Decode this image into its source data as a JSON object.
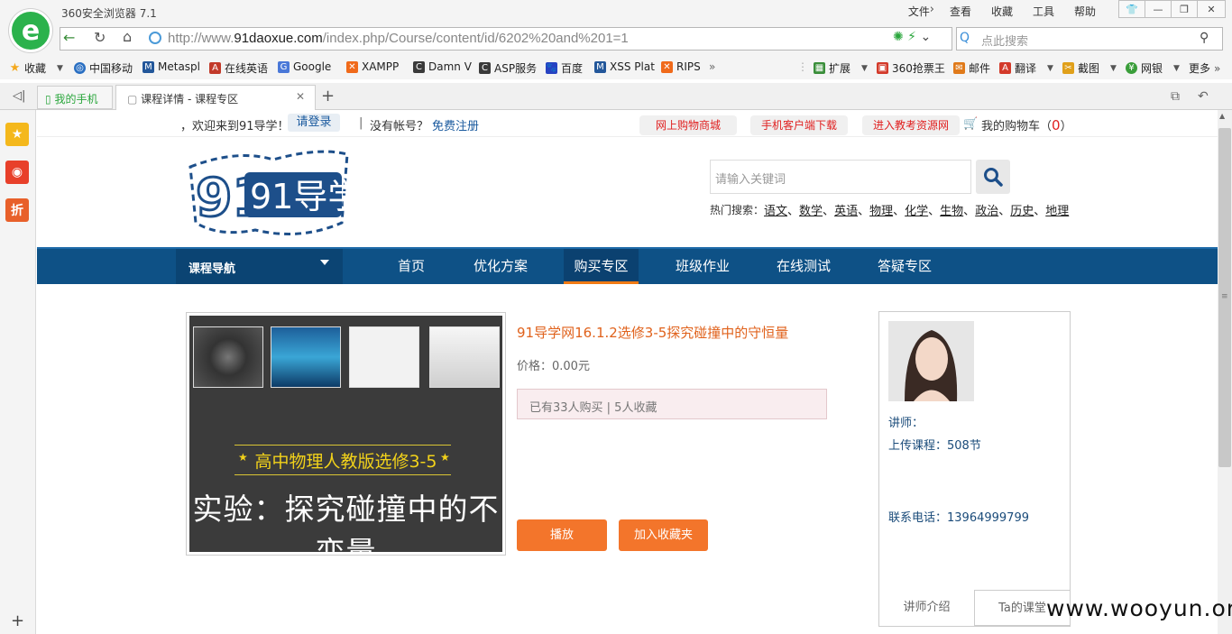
{
  "browser": {
    "app_title": "360安全浏览器 7.1",
    "menus": [
      "文件",
      "查看",
      "收藏",
      "工具",
      "帮助"
    ],
    "url_prefix": "http://www.",
    "url_domain": "91daoxue.com",
    "url_path": "/index.php/Course/content/id/6202%20and%201=1",
    "search_placeholder": "点此搜索",
    "bookmarks_left": [
      {
        "label": "收藏",
        "icon": "star-icon",
        "color": "#f4a81c"
      },
      {
        "label": "中国移动",
        "icon": "china-mobile-icon",
        "color": "#2a6fc2"
      },
      {
        "label": "Metaspl",
        "icon": "metasploit-icon",
        "color": "#23579a"
      },
      {
        "label": "在线英语",
        "icon": "english-icon",
        "color": "#c23a2a"
      },
      {
        "label": "Google",
        "icon": "google-icon",
        "color": "#4a78d8"
      },
      {
        "label": "XAMPP",
        "icon": "xampp-icon",
        "color": "#f06a1a"
      },
      {
        "label": "Damn V",
        "icon": "dvwa-icon",
        "color": "#3a3a3a"
      },
      {
        "label": "ASP服务",
        "icon": "asp-icon",
        "color": "#3a3a3a"
      },
      {
        "label": "百度",
        "icon": "baidu-icon",
        "color": "#2742c2"
      },
      {
        "label": "XSS Plat",
        "icon": "xss-icon",
        "color": "#23579a"
      },
      {
        "label": "RIPS",
        "icon": "rips-icon",
        "color": "#f06a1a"
      }
    ],
    "bookmarks_right": [
      {
        "label": "扩展",
        "icon": "extension-icon",
        "color": "#3a8e3a"
      },
      {
        "label": "360抢票王",
        "icon": "ticket-icon",
        "color": "#d33a2a"
      },
      {
        "label": "邮件",
        "icon": "mail-icon",
        "color": "#e07a1a"
      },
      {
        "label": "翻译",
        "icon": "translate-icon",
        "color": "#d33a2a"
      },
      {
        "label": "截图",
        "icon": "screenshot-icon",
        "color": "#e0a01a"
      },
      {
        "label": "网银",
        "icon": "bank-icon",
        "color": "#3a9e3a"
      },
      {
        "label": "更多",
        "icon": "",
        "color": ""
      }
    ],
    "tabs": [
      {
        "label": "我的手机"
      },
      {
        "label": "课程详情 - 课程专区"
      }
    ]
  },
  "page": {
    "welcome": "，欢迎来到91导学！",
    "login": "请登录",
    "separator": "|",
    "no_account": "没有帐号？",
    "register": "免费注册",
    "top_links": [
      "网上购物商城",
      "手机客户端下载",
      "进入教考资源网"
    ],
    "cart_label": "我的购物车（",
    "cart_count": "0",
    "cart_close": "）",
    "logo_text": "91导学",
    "search_placeholder": "请输入关键词",
    "hot_label": "热门搜索：",
    "hot_links": [
      "语文",
      "数学",
      "英语",
      "物理",
      "化学",
      "生物",
      "政治",
      "历史",
      "地理"
    ],
    "nav_course": "课程导航",
    "nav_items": [
      "首页",
      "优化方案",
      "购买专区",
      "班级作业",
      "在线测试",
      "答疑专区"
    ],
    "nav_active": "购买专区"
  },
  "course": {
    "image_subtitle": "高中物理人教版选修3-5",
    "image_title": "实验：探究碰撞中的不变量",
    "title": "91导学网16.1.2选修3-5探究碰撞中的守恒量",
    "price": "价格：0.00元",
    "stats": "已有33人购买 | 5人收藏",
    "play": "播放",
    "favorite": "加入收藏夹"
  },
  "teacher": {
    "label": "讲师：",
    "uploads": "上传课程：508节",
    "phone": "联系电话：13964999799",
    "tab_intro": "讲师介绍",
    "tab_courses": "Ta的课堂"
  },
  "watermark": "www.wooyun.org",
  "colors": {
    "nav_bg": "#0e5186",
    "accent_orange": "#f3752b",
    "title_orange": "#e0621c",
    "browser_green": "#2bb24c"
  }
}
